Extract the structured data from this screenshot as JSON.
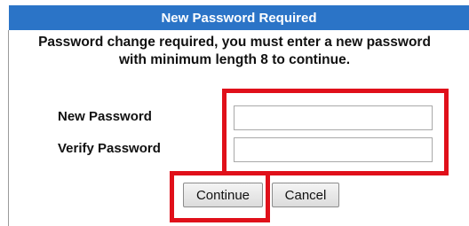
{
  "dialog": {
    "title": "New Password Required",
    "message_line1": "Password change required, you must enter a new password",
    "message_line2": "with minimum length 8 to continue."
  },
  "form": {
    "new_password_label": "New Password",
    "new_password_value": "",
    "verify_password_label": "Verify Password",
    "verify_password_value": ""
  },
  "buttons": {
    "continue_label": "Continue",
    "cancel_label": "Cancel"
  },
  "colors": {
    "title_background": "#2b74c7",
    "annotation_red": "#e0101a"
  }
}
